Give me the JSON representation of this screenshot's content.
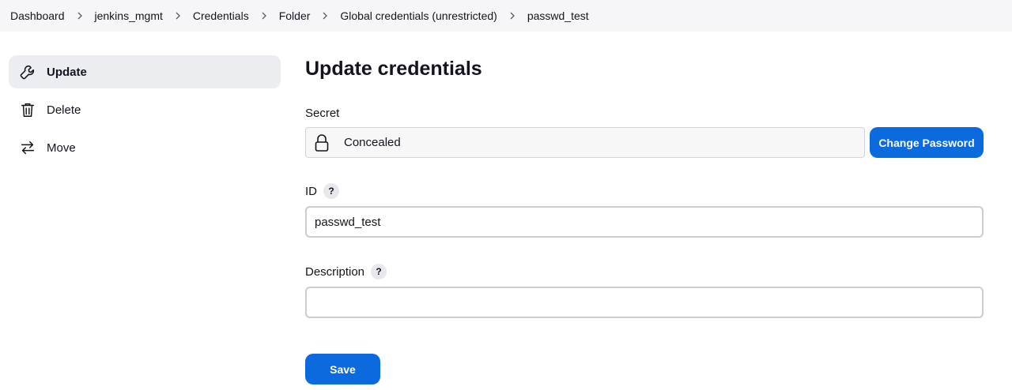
{
  "breadcrumb": [
    {
      "label": "Dashboard"
    },
    {
      "label": "jenkins_mgmt"
    },
    {
      "label": "Credentials"
    },
    {
      "label": "Folder"
    },
    {
      "label": "Global credentials (unrestricted)"
    },
    {
      "label": "passwd_test"
    }
  ],
  "sidebar": {
    "items": [
      {
        "label": "Update",
        "icon": "wrench-icon",
        "active": true
      },
      {
        "label": "Delete",
        "icon": "trash-icon"
      },
      {
        "label": "Move",
        "icon": "arrows-swap-icon"
      }
    ]
  },
  "main": {
    "title": "Update credentials",
    "secret": {
      "label": "Secret",
      "value": "Concealed",
      "icon": "lock-icon",
      "change_button": "Change Password"
    },
    "id_field": {
      "label": "ID",
      "help": "?",
      "value": "passwd_test"
    },
    "description_field": {
      "label": "Description",
      "help": "?",
      "value": ""
    },
    "save_button": "Save"
  },
  "colors": {
    "primary": "#0b6bde",
    "breadcrumb_bg": "#f6f6f8",
    "active_item_bg": "#ebedf1"
  }
}
